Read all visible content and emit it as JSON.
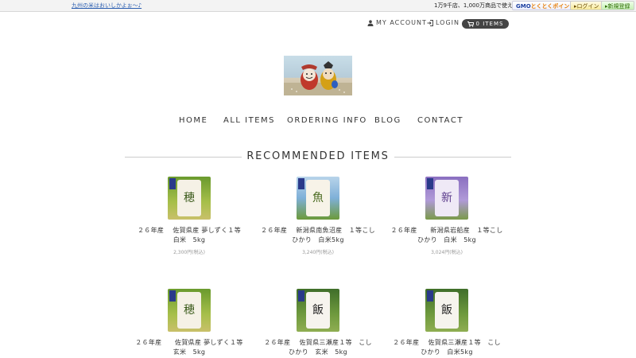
{
  "topbar": {
    "promo_link": "九州の米はおいしかよぉ～♪",
    "gmo_text": "1万9千店、1,000万商品で使える",
    "gmo_logo_a": "GMO",
    "gmo_logo_b": "とくとくポイント",
    "login_label": "ログイン",
    "signup_label": "新規登録"
  },
  "account_nav": {
    "my_account": "MY ACCOUNT",
    "login": "LOGIN",
    "cart": "0 ITEMS"
  },
  "nav": {
    "home": "HOME",
    "all_items": "ALL ITEMS",
    "ordering_info": "ORDERING INFO",
    "blog": "BLOG",
    "contact": "CONTACT"
  },
  "section_title": "RECOMMENDED ITEMS",
  "products": [
    {
      "line1": "２６年産　 佐賀県産  夢しずく１等",
      "line2": "白米　5kg",
      "price": "2,300円(税込)"
    },
    {
      "line1": "２６年産　 新潟県南魚沼産　１等こし",
      "line2": "ひかり　白米5kg",
      "price": "3,240円(税込)"
    },
    {
      "line1": "２６年産　　新潟県岩船産　１等こし",
      "line2": "ひかり　白米　5kg",
      "price": "3,024円(税込)"
    },
    {
      "line1": "２６年産　　佐賀県産 夢しずく１等",
      "line2": "玄米　5kg",
      "price": ""
    },
    {
      "line1": "２６年産　 佐賀県三瀬産１等　こし",
      "line2": "ひかり　玄米　5kg",
      "price": ""
    },
    {
      "line1": "２６年産　 佐賀県三瀬産１等　こし",
      "line2": "ひかり　白米5kg",
      "price": ""
    }
  ]
}
